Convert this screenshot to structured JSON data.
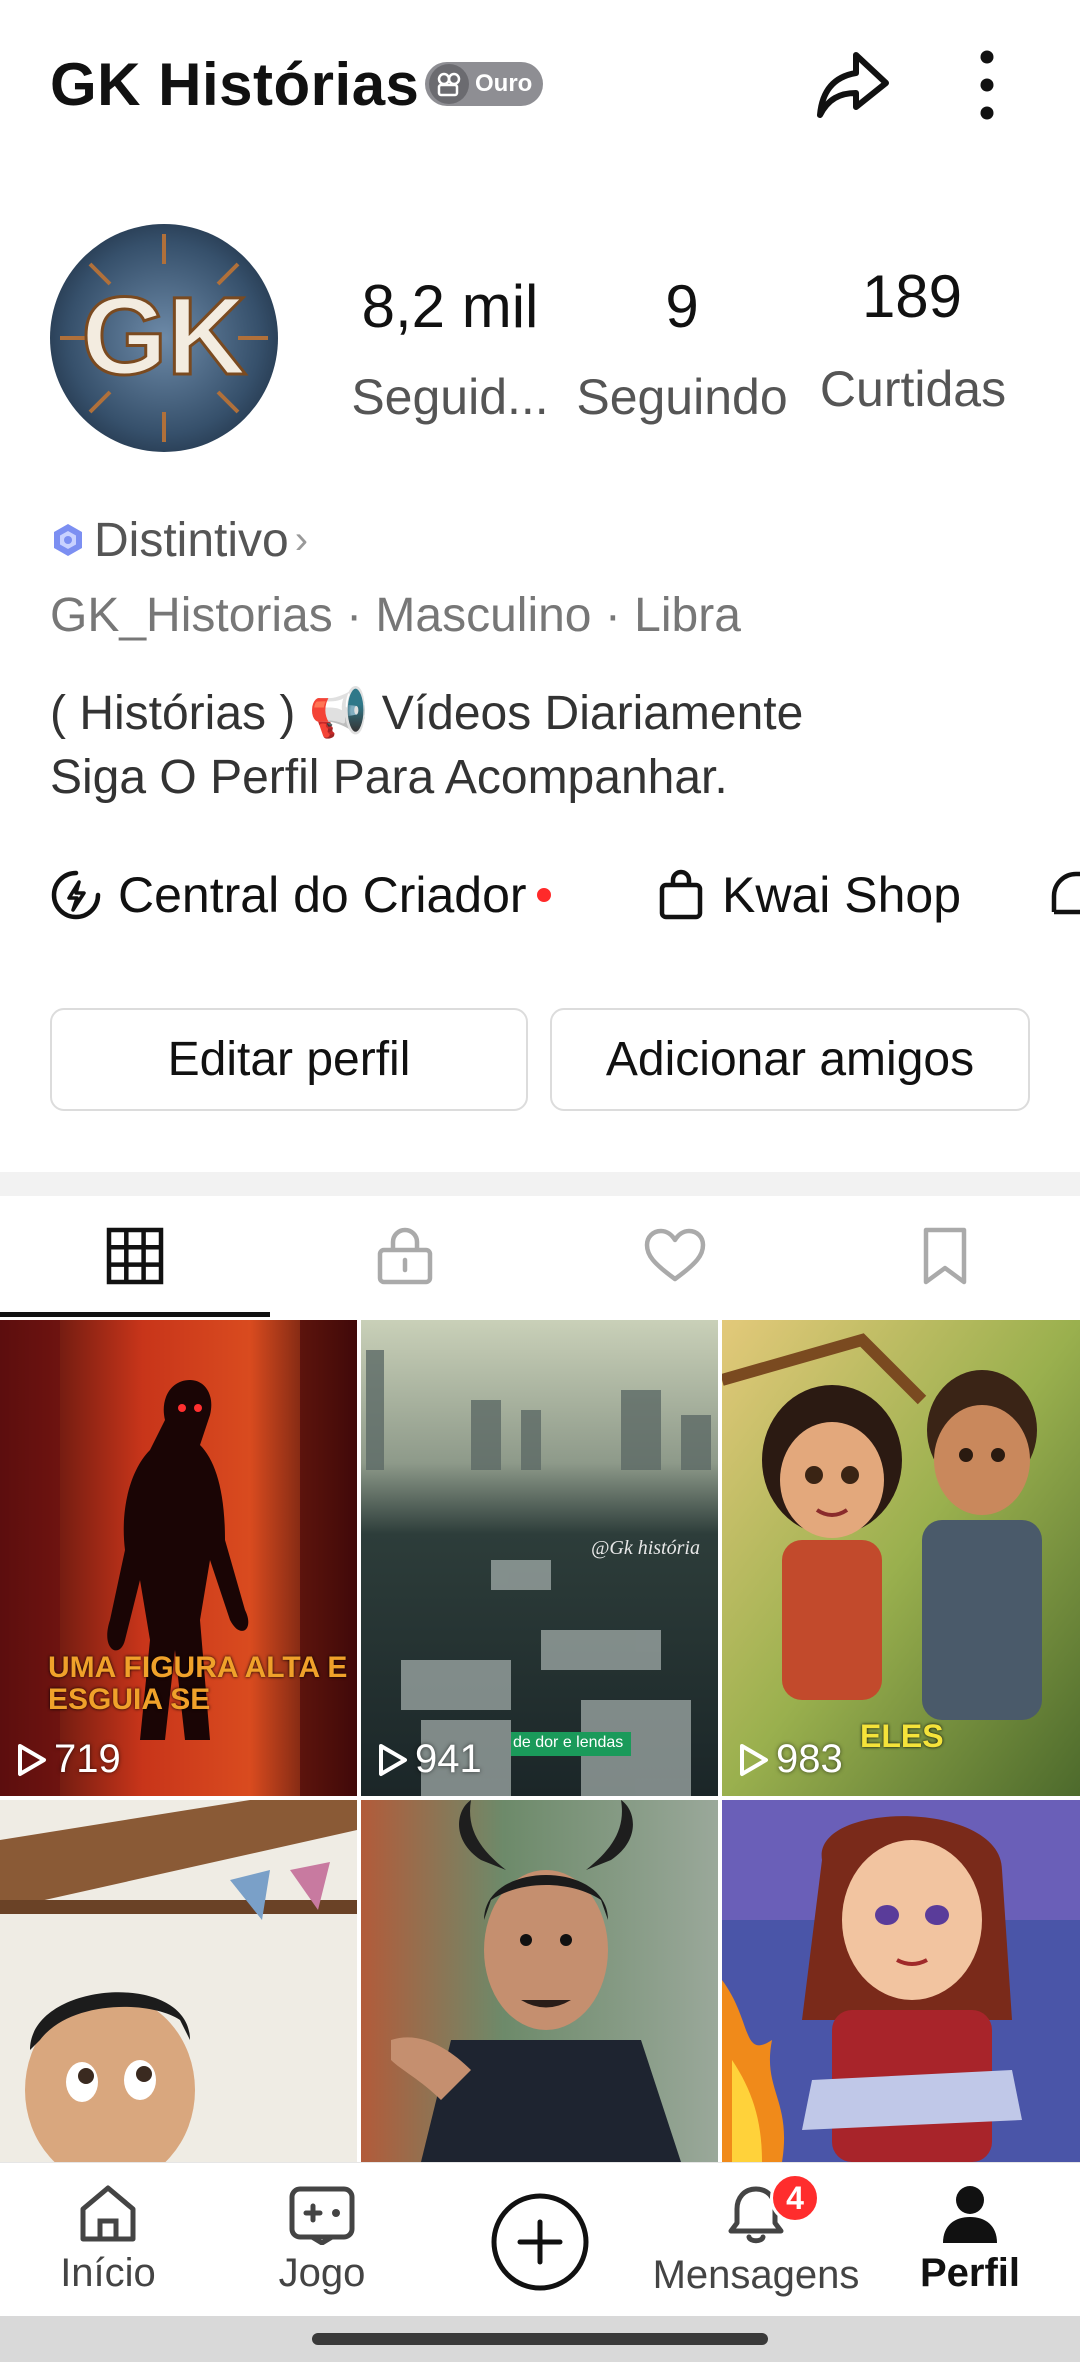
{
  "header": {
    "title": "GK Histórias",
    "badge_label": "Ouro"
  },
  "profile": {
    "avatar_text": "GK",
    "stats": [
      {
        "value": "8,2 mil",
        "label": "Seguid..."
      },
      {
        "value": "9",
        "label": "Seguindo"
      },
      {
        "value": "189",
        "label": "Curtidas"
      }
    ],
    "distintivo": "Distintivo",
    "info_line": "GK_Historias · Masculino · Libra",
    "bio_line1": "( Histórias )  📢 Vídeos Diariamente",
    "bio_line2": "Siga O Perfil Para Acompanhar."
  },
  "links": {
    "creator_center": "Central do Criador",
    "kwai_shop": "Kwai Shop"
  },
  "buttons": {
    "edit_profile": "Editar perfil",
    "add_friends": "Adicionar amigos"
  },
  "tabs": [
    {
      "icon": "grid-icon",
      "active": true
    },
    {
      "icon": "lock-icon",
      "active": false
    },
    {
      "icon": "heart-icon",
      "active": false
    },
    {
      "icon": "bookmark-icon",
      "active": false
    }
  ],
  "videos": [
    {
      "views": "719",
      "caption": "UMA FIGURA ALTA E ESGUIA SE"
    },
    {
      "views": "941",
      "caption": "de dor e lendas",
      "watermark": "@Gk história"
    },
    {
      "views": "983",
      "caption": "ELES"
    },
    {
      "views": ""
    },
    {
      "views": ""
    },
    {
      "views": ""
    }
  ],
  "bottom_nav": [
    {
      "label": "Início",
      "icon": "home-icon"
    },
    {
      "label": "Jogo",
      "icon": "gamepad-icon"
    },
    {
      "label": "",
      "icon": "plus-circle-icon"
    },
    {
      "label": "Mensagens",
      "icon": "bell-icon",
      "badge": "4"
    },
    {
      "label": "Perfil",
      "icon": "person-icon",
      "active": true
    }
  ],
  "colors": {
    "accent_red": "#ff2d2d",
    "text_primary": "#111111",
    "text_secondary": "#555555",
    "badge_gray": "#8e8e93"
  }
}
